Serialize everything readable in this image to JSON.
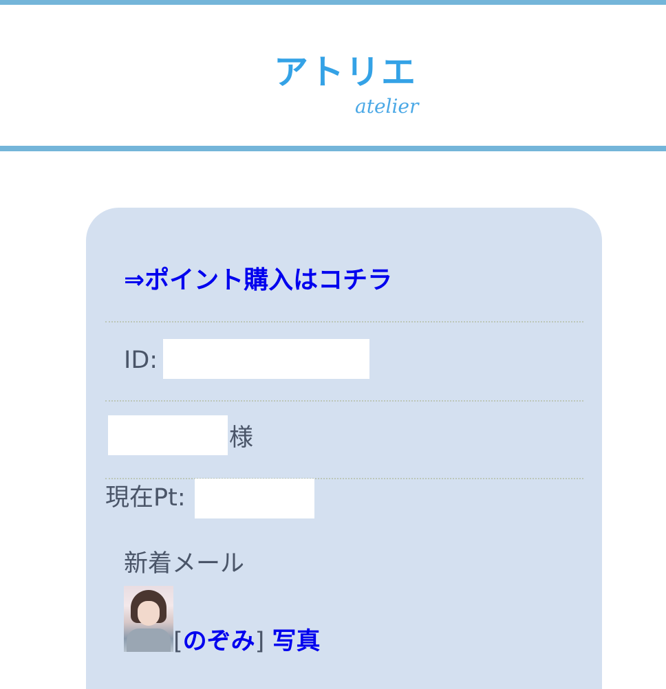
{
  "header": {
    "logo_main": "アトリエ",
    "logo_sub": "atelier",
    "accent_color": "#74b5d9",
    "logo_color": "#34a2e6"
  },
  "panel": {
    "background_color": "#d4e0f0",
    "points_link": "⇒ポイント購入はコチラ",
    "id_label": "ID:",
    "name_suffix": "様",
    "points_label": "現在Pt:",
    "new_mail_label": "新着メール",
    "mail": {
      "bracket_open": "[",
      "sender": "のぞみ",
      "bracket_close": "]",
      "subject": "写真"
    }
  }
}
